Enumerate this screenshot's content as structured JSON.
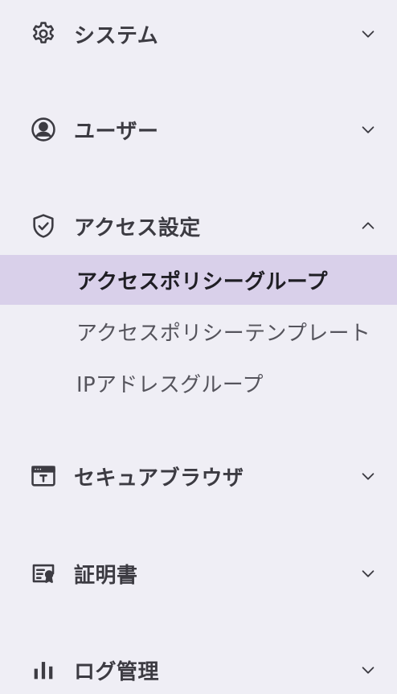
{
  "sidebar": {
    "items": [
      {
        "label": "システム",
        "icon": "gear-icon",
        "expanded": false
      },
      {
        "label": "ユーザー",
        "icon": "user-circle-icon",
        "expanded": false
      },
      {
        "label": "アクセス設定",
        "icon": "shield-check-icon",
        "expanded": true,
        "children": [
          {
            "label": "アクセスポリシーグループ",
            "active": true
          },
          {
            "label": "アクセスポリシーテンプレート",
            "active": false
          },
          {
            "label": "IPアドレスグループ",
            "active": false
          }
        ]
      },
      {
        "label": "セキュアブラウザ",
        "icon": "browser-window-icon",
        "expanded": false
      },
      {
        "label": "証明書",
        "icon": "certificate-icon",
        "expanded": false
      },
      {
        "label": "ログ管理",
        "icon": "bar-chart-icon",
        "expanded": false
      }
    ]
  },
  "colors": {
    "background": "#efeef5",
    "active_highlight": "#d9d0ea",
    "text": "#3c3b42"
  }
}
